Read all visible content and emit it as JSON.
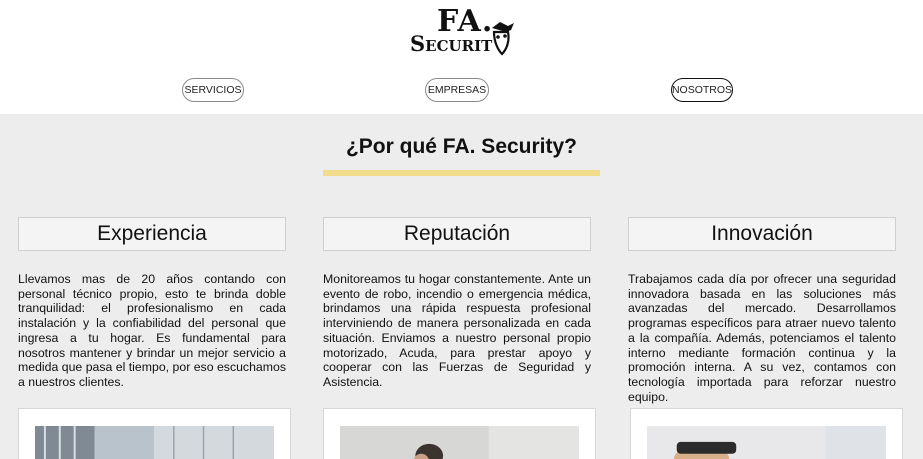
{
  "logo": {
    "line1": "FA.",
    "line2": "Securit",
    "icon": "shield-mascot-icon"
  },
  "nav": {
    "servicios": "SERVICIOS",
    "empresas": "EMPRESAS",
    "nosotros": "NOSOTROS"
  },
  "section": {
    "title": "¿Por qué FA. Security?"
  },
  "colors": {
    "accent_underline": "#f1dc8c",
    "background": "#ededed"
  },
  "cards": [
    {
      "title": "Experiencia",
      "text": "Llevamos mas de 20 años contando con personal técnico propio, esto te brinda doble tranquilidad: el profesionalismo en cada instalación y la confiabilidad del personal que ingresa a tu hogar. Es fundamental para nosotros mantener y brindar un mejor servicio a medida que pasa el tiempo, por eso escuchamos a nuestros clientes."
    },
    {
      "title": "Reputación",
      "text": "Monitoreamos tu hogar constantemente. Ante un evento de robo, incendio o emergencia médica, brindamos una rápida respuesta profesional interviniendo de manera personalizada en cada situación. Enviamos a nuestro personal propio motorizado, Acuda, para prestar apoyo y cooperar con las Fuerzas de Seguridad y Asistencia."
    },
    {
      "title": "Innovación",
      "text": "Trabajamos cada día por ofrecer una seguridad innovadora basada en las soluciones más avanzadas del mercado. Desarrollamos programas específicos para atraer nuevo talento a la compañía. Además, potenciamos el talento interno mediante formación continua y la promoción interna. A su vez, contamos con tecnología importada para reforzar nuestro equipo."
    }
  ]
}
